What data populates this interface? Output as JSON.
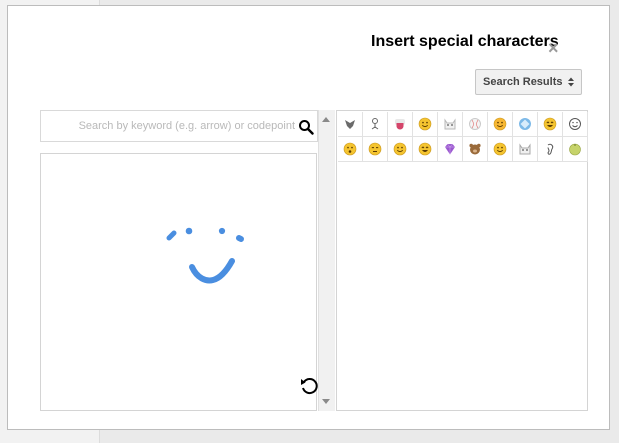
{
  "dialog": {
    "title": "Insert special characters",
    "close_symbol": "×",
    "category_dropdown": {
      "selected": "Search Results"
    }
  },
  "search": {
    "placeholder": "Search by keyword (e.g. arrow) or codepoint",
    "value": ""
  },
  "handwriting": {
    "reset_icon": "reset-icon",
    "drawn_shape": "smiley face sketch"
  },
  "results": {
    "items": [
      {
        "icon": "masked-face-icon",
        "color": "#6a6a6a"
      },
      {
        "icon": "stick-figure-icon",
        "color": "#666666"
      },
      {
        "icon": "tongue-icon",
        "color": "#d4456a"
      },
      {
        "icon": "smiling-face-icon",
        "color": "#f4c430"
      },
      {
        "icon": "cat-face-icon",
        "color": "#b9b9b9"
      },
      {
        "icon": "baseball-icon",
        "color": "#c9c9c9"
      },
      {
        "icon": "smiling-face-icon",
        "color": "#f7b733"
      },
      {
        "icon": "diamond-shape-icon",
        "color": "#7cb9e8"
      },
      {
        "icon": "laughing-face-icon",
        "color": "#f4c430"
      },
      {
        "icon": "outlined-smile-icon",
        "color": "#555555"
      },
      {
        "icon": "surprised-face-icon",
        "color": "#f4c430"
      },
      {
        "icon": "unamused-face-icon",
        "color": "#f4c430"
      },
      {
        "icon": "grinning-face-icon",
        "color": "#f4c430"
      },
      {
        "icon": "sweat-smile-face-icon",
        "color": "#f4c430"
      },
      {
        "icon": "gem-icon",
        "color": "#9b59d0"
      },
      {
        "icon": "bear-face-icon",
        "color": "#9a6a3a"
      },
      {
        "icon": "grinning-face-icon",
        "color": "#f4c430"
      },
      {
        "icon": "robot-face-icon",
        "color": "#a8a8a8"
      },
      {
        "icon": "ear-icon",
        "color": "#555555"
      },
      {
        "icon": "melon-icon",
        "color": "#c6d36a"
      }
    ]
  },
  "colors": {
    "accent_stroke": "#4a8ee0"
  }
}
